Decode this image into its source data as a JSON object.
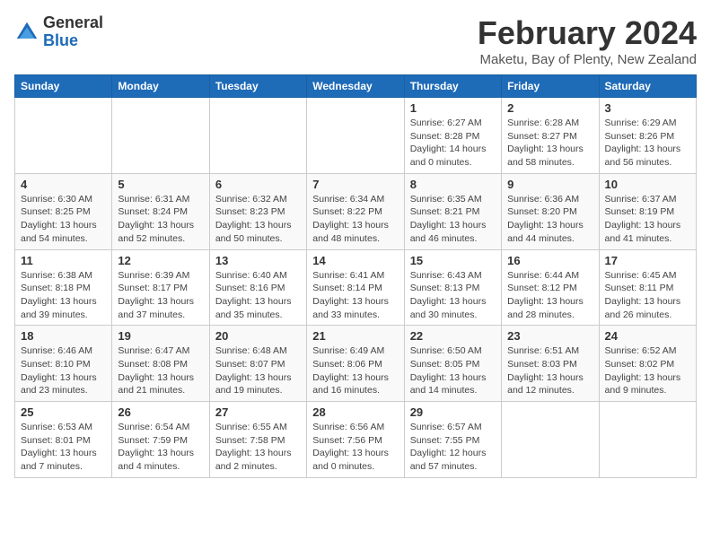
{
  "logo": {
    "general": "General",
    "blue": "Blue"
  },
  "title": {
    "month_year": "February 2024",
    "location": "Maketu, Bay of Plenty, New Zealand"
  },
  "days_of_week": [
    "Sunday",
    "Monday",
    "Tuesday",
    "Wednesday",
    "Thursday",
    "Friday",
    "Saturday"
  ],
  "weeks": [
    [
      {
        "day": "",
        "info": ""
      },
      {
        "day": "",
        "info": ""
      },
      {
        "day": "",
        "info": ""
      },
      {
        "day": "",
        "info": ""
      },
      {
        "day": "1",
        "info": "Sunrise: 6:27 AM\nSunset: 8:28 PM\nDaylight: 14 hours\nand 0 minutes."
      },
      {
        "day": "2",
        "info": "Sunrise: 6:28 AM\nSunset: 8:27 PM\nDaylight: 13 hours\nand 58 minutes."
      },
      {
        "day": "3",
        "info": "Sunrise: 6:29 AM\nSunset: 8:26 PM\nDaylight: 13 hours\nand 56 minutes."
      }
    ],
    [
      {
        "day": "4",
        "info": "Sunrise: 6:30 AM\nSunset: 8:25 PM\nDaylight: 13 hours\nand 54 minutes."
      },
      {
        "day": "5",
        "info": "Sunrise: 6:31 AM\nSunset: 8:24 PM\nDaylight: 13 hours\nand 52 minutes."
      },
      {
        "day": "6",
        "info": "Sunrise: 6:32 AM\nSunset: 8:23 PM\nDaylight: 13 hours\nand 50 minutes."
      },
      {
        "day": "7",
        "info": "Sunrise: 6:34 AM\nSunset: 8:22 PM\nDaylight: 13 hours\nand 48 minutes."
      },
      {
        "day": "8",
        "info": "Sunrise: 6:35 AM\nSunset: 8:21 PM\nDaylight: 13 hours\nand 46 minutes."
      },
      {
        "day": "9",
        "info": "Sunrise: 6:36 AM\nSunset: 8:20 PM\nDaylight: 13 hours\nand 44 minutes."
      },
      {
        "day": "10",
        "info": "Sunrise: 6:37 AM\nSunset: 8:19 PM\nDaylight: 13 hours\nand 41 minutes."
      }
    ],
    [
      {
        "day": "11",
        "info": "Sunrise: 6:38 AM\nSunset: 8:18 PM\nDaylight: 13 hours\nand 39 minutes."
      },
      {
        "day": "12",
        "info": "Sunrise: 6:39 AM\nSunset: 8:17 PM\nDaylight: 13 hours\nand 37 minutes."
      },
      {
        "day": "13",
        "info": "Sunrise: 6:40 AM\nSunset: 8:16 PM\nDaylight: 13 hours\nand 35 minutes."
      },
      {
        "day": "14",
        "info": "Sunrise: 6:41 AM\nSunset: 8:14 PM\nDaylight: 13 hours\nand 33 minutes."
      },
      {
        "day": "15",
        "info": "Sunrise: 6:43 AM\nSunset: 8:13 PM\nDaylight: 13 hours\nand 30 minutes."
      },
      {
        "day": "16",
        "info": "Sunrise: 6:44 AM\nSunset: 8:12 PM\nDaylight: 13 hours\nand 28 minutes."
      },
      {
        "day": "17",
        "info": "Sunrise: 6:45 AM\nSunset: 8:11 PM\nDaylight: 13 hours\nand 26 minutes."
      }
    ],
    [
      {
        "day": "18",
        "info": "Sunrise: 6:46 AM\nSunset: 8:10 PM\nDaylight: 13 hours\nand 23 minutes."
      },
      {
        "day": "19",
        "info": "Sunrise: 6:47 AM\nSunset: 8:08 PM\nDaylight: 13 hours\nand 21 minutes."
      },
      {
        "day": "20",
        "info": "Sunrise: 6:48 AM\nSunset: 8:07 PM\nDaylight: 13 hours\nand 19 minutes."
      },
      {
        "day": "21",
        "info": "Sunrise: 6:49 AM\nSunset: 8:06 PM\nDaylight: 13 hours\nand 16 minutes."
      },
      {
        "day": "22",
        "info": "Sunrise: 6:50 AM\nSunset: 8:05 PM\nDaylight: 13 hours\nand 14 minutes."
      },
      {
        "day": "23",
        "info": "Sunrise: 6:51 AM\nSunset: 8:03 PM\nDaylight: 13 hours\nand 12 minutes."
      },
      {
        "day": "24",
        "info": "Sunrise: 6:52 AM\nSunset: 8:02 PM\nDaylight: 13 hours\nand 9 minutes."
      }
    ],
    [
      {
        "day": "25",
        "info": "Sunrise: 6:53 AM\nSunset: 8:01 PM\nDaylight: 13 hours\nand 7 minutes."
      },
      {
        "day": "26",
        "info": "Sunrise: 6:54 AM\nSunset: 7:59 PM\nDaylight: 13 hours\nand 4 minutes."
      },
      {
        "day": "27",
        "info": "Sunrise: 6:55 AM\nSunset: 7:58 PM\nDaylight: 13 hours\nand 2 minutes."
      },
      {
        "day": "28",
        "info": "Sunrise: 6:56 AM\nSunset: 7:56 PM\nDaylight: 13 hours\nand 0 minutes."
      },
      {
        "day": "29",
        "info": "Sunrise: 6:57 AM\nSunset: 7:55 PM\nDaylight: 12 hours\nand 57 minutes."
      },
      {
        "day": "",
        "info": ""
      },
      {
        "day": "",
        "info": ""
      }
    ]
  ]
}
